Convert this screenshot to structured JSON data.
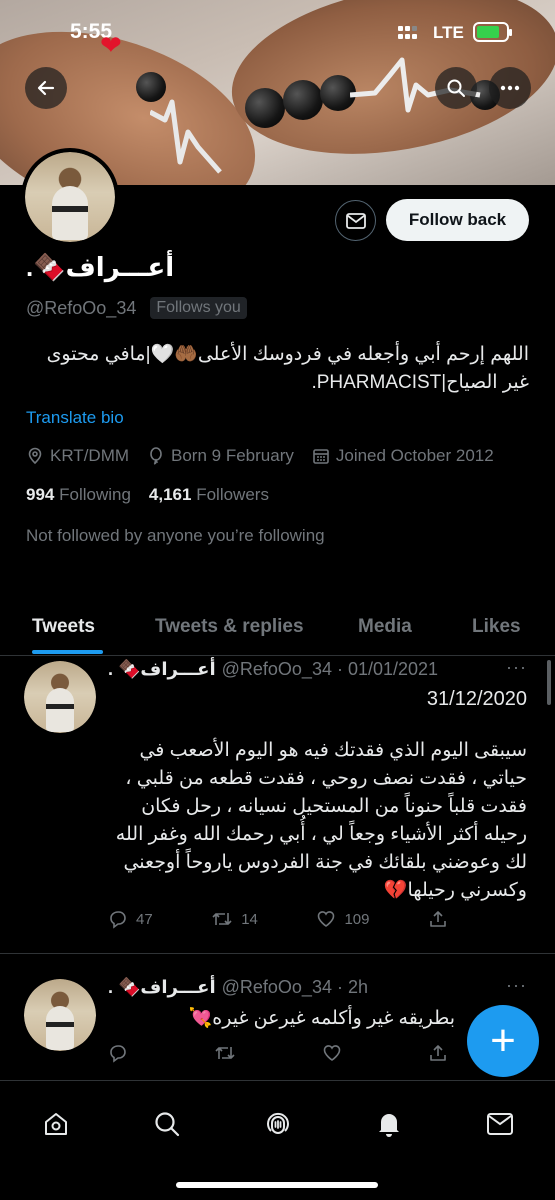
{
  "status_bar": {
    "time": "5:55",
    "network": "LTE"
  },
  "header_buttons": {
    "back": "back-icon",
    "search": "search-icon",
    "more": "more-icon"
  },
  "profile": {
    "display_name": "أعـــراف🍫.",
    "handle": "@RefoOo_34",
    "follows_you": "Follows you",
    "follow_back_label": "Follow back",
    "bio": "اللهم إرحم أبي وأجعله في فردوسك الأعلى🤲🏾🤍|مافي محتوى غير الصياح|PHARMACIST.",
    "translate_bio": "Translate bio",
    "location": "KRT/DMM",
    "birthday": "Born 9 February",
    "joined": "Joined October 2012",
    "following_count": "994",
    "following_label": "Following",
    "followers_count": "4,161",
    "followers_label": "Followers",
    "not_followed_note": "Not followed by anyone you’re following"
  },
  "tabs": [
    {
      "label": "Tweets",
      "active": true
    },
    {
      "label": "Tweets & replies",
      "active": false
    },
    {
      "label": "Media",
      "active": false
    },
    {
      "label": "Likes",
      "active": false
    }
  ],
  "tweets": [
    {
      "display_name": "أعـــراف🍫 .",
      "meta": "@RefoOo_34 · 01/01/2021",
      "date_line": "31/12/2020",
      "text": "سيبقى اليوم الذي فقدتك فيه هو اليوم الأصعب في حياتي ، فقدت نصف روحي ، فقدت قطعه من قلبي ، فقدت قلباً حنوناً من المستحيل نسيانه ، رحل فكان رحيله أكثر الأشياء وجعاً لي ، أُبي رحمك الله وغفر الله لك وعوضني بلقائك في جنة الفردوس ياروحاً أوجعني وكسرني رحيلها💔",
      "replies": "47",
      "retweets": "14",
      "likes": "109"
    },
    {
      "display_name": "أعـــراف🍫 .",
      "meta": "@RefoOo_34 · 2h",
      "text": "بطريقه غير وأكلمه غيرعن غيره💘"
    }
  ],
  "fab_label": "+",
  "bottom_nav": [
    "home-icon",
    "explore-icon",
    "spaces-icon",
    "notifications-icon",
    "messages-icon"
  ]
}
